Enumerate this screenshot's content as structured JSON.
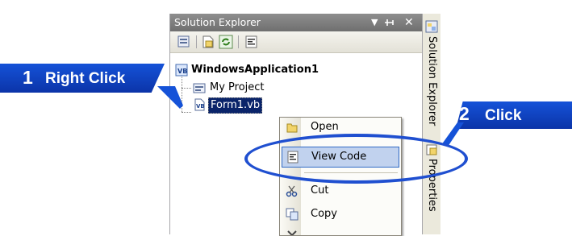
{
  "panel": {
    "title": "Solution Explorer",
    "controls": {
      "dropdown": "▾",
      "pin": "ᴾ",
      "close": "✕"
    }
  },
  "tree": {
    "solution": "WindowsApplication1",
    "project_item": "My Project",
    "selected_item": "Form1.vb"
  },
  "side_tabs": {
    "solution_explorer": "Solution Explorer",
    "properties": "Properties"
  },
  "context_menu": {
    "items": [
      {
        "label": "Open",
        "icon": "open-icon",
        "state": "partially-hidden"
      },
      {
        "label": "View Code",
        "icon": "view-code-icon",
        "state": "selected"
      },
      {
        "label": "Cut",
        "icon": "cut-icon",
        "state": "partially-hidden"
      },
      {
        "label": "Copy",
        "icon": "copy-icon",
        "state": "normal"
      }
    ]
  },
  "callouts": [
    {
      "number": "1",
      "label": "Right Click"
    },
    {
      "number": "2",
      "label": "Click"
    }
  ],
  "colors": {
    "callout": "#1552d8",
    "highlight": "#316ac5",
    "selection": "#0a246a"
  }
}
